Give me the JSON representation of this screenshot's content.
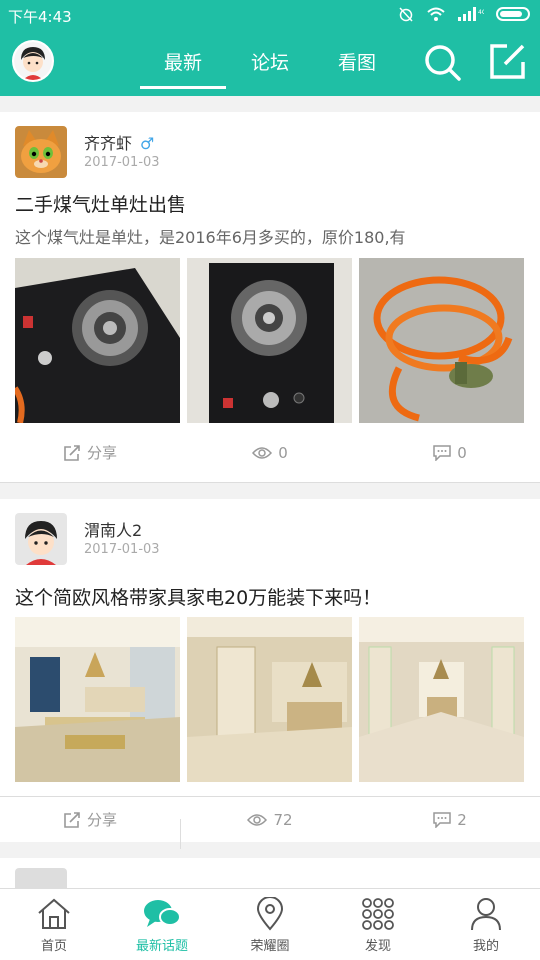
{
  "status": {
    "time": "下午4:43",
    "network": "4G"
  },
  "header": {
    "tabs": [
      "最新",
      "论坛",
      "看图"
    ],
    "active_tab": "最新",
    "icons": [
      "search-icon",
      "compose-icon"
    ]
  },
  "posts": [
    {
      "user": "齐齐虾",
      "gender": "♂",
      "date": "2017-01-03",
      "title": "二手煤气灶单灶出售",
      "excerpt": "这个煤气灶是单灶，是2016年6月多买的，原价180,有",
      "share": "分享",
      "views": "0",
      "comments": "0"
    },
    {
      "user": "渭南人2",
      "date": "2017-01-03",
      "title": "这个简欧风格带家具家电20万能装下来吗！",
      "share": "分享",
      "views": "72",
      "comments": "2"
    }
  ],
  "bottom_nav": [
    "首页",
    "最新话题",
    "荣耀圈",
    "发现",
    "我的"
  ],
  "colors": {
    "accent": "#1fbfa5"
  }
}
